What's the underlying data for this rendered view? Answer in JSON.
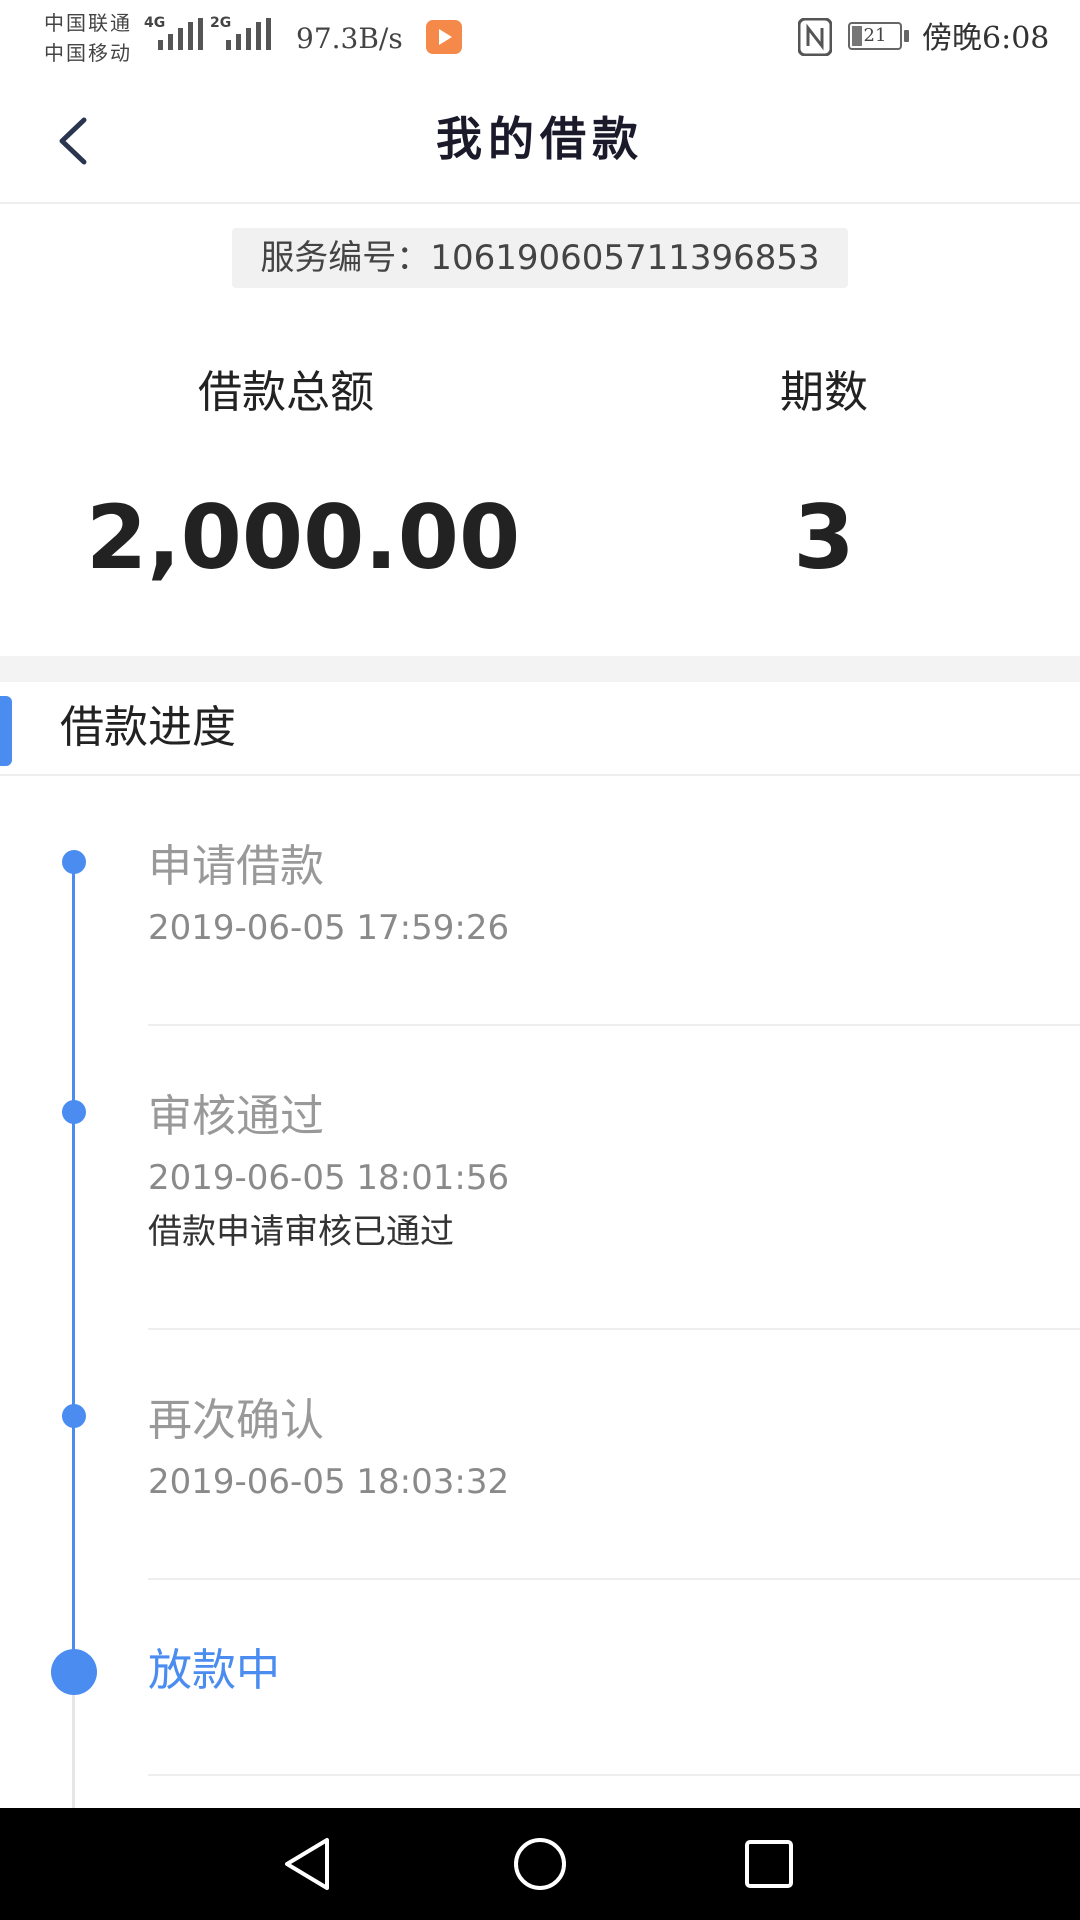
{
  "status_bar": {
    "carrier_1": "中国联通",
    "carrier_2": "中国移动",
    "network_1": "4G",
    "network_2": "2G",
    "net_speed": "97.3B/s",
    "battery_level": "21",
    "time": "傍晚6:08",
    "icons": [
      "signal-icon",
      "app-notification-icon",
      "nfc-icon",
      "battery-icon"
    ]
  },
  "header": {
    "title": "我的借款",
    "back_icon": "back-arrow-icon"
  },
  "service": {
    "text": "服务编号：106190605711396853"
  },
  "summary": {
    "total_label": "借款总额",
    "total_value": "2,000.00",
    "periods_label": "期数",
    "periods_value": "3"
  },
  "progress": {
    "section_title": "借款进度",
    "steps": [
      {
        "title": "申请借款",
        "time": "2019-06-05 17:59:26"
      },
      {
        "title": "审核通过",
        "time": "2019-06-05 18:01:56",
        "desc": "借款申请审核已通过"
      },
      {
        "title": "再次确认",
        "time": "2019-06-05 18:03:32"
      },
      {
        "title": "放款中"
      }
    ]
  },
  "colors": {
    "accent": "#4a8cf0",
    "muted_text": "#999999",
    "nav_bar": "#000000"
  },
  "nav": {
    "icons": [
      "nav-back-icon",
      "nav-home-icon",
      "nav-recent-icon"
    ]
  }
}
